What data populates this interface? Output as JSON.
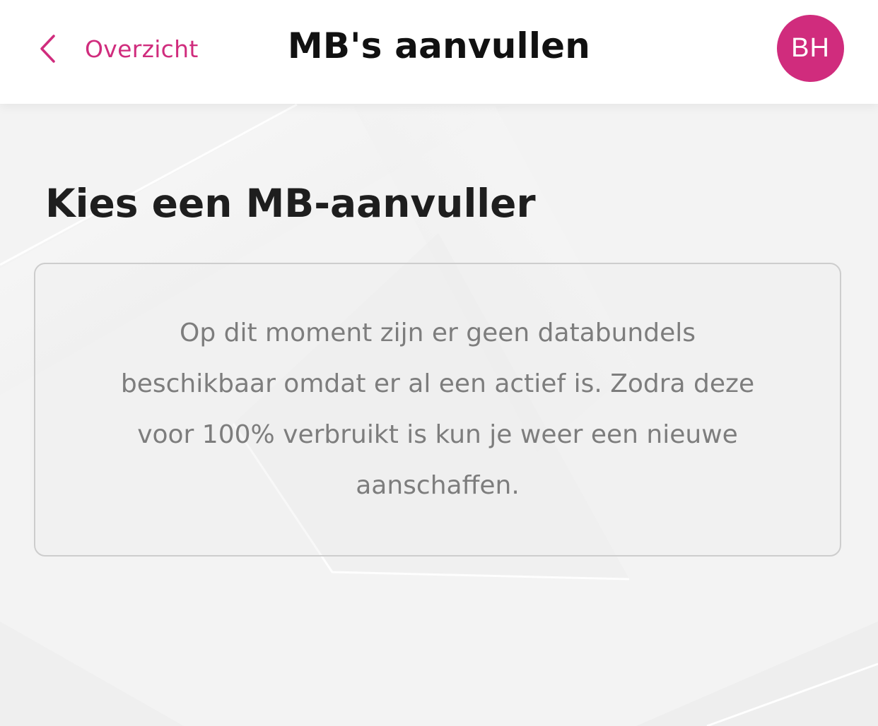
{
  "header": {
    "back_label": "Overzicht",
    "title": "MB's aanvullen",
    "avatar_initials": "BH"
  },
  "main": {
    "heading": "Kies een MB-aanvuller",
    "notice": "Op dit moment zijn er geen databundels beschikbaar omdat er al een actief is. Zodra deze voor 100% verbruikt is kun je weer een nieuwe aanschaffen."
  },
  "icons": {
    "back": "chevron-left-icon"
  },
  "colors": {
    "accent": "#d02c7d",
    "background": "#f3f3f3",
    "header_background": "#ffffff",
    "notice_text": "#7d7d7d",
    "card_border": "#cdcdcd"
  }
}
